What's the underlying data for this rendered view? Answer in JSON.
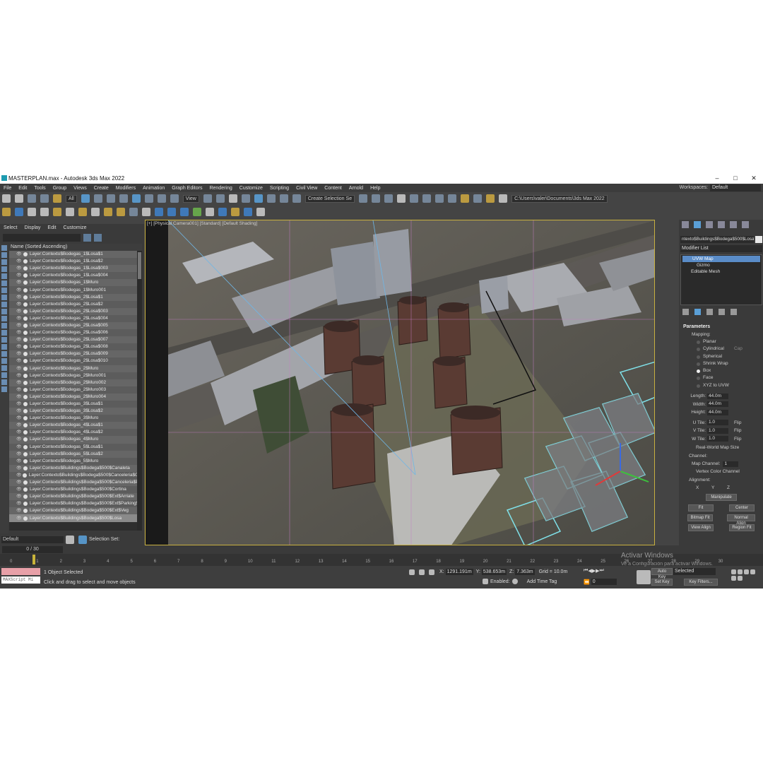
{
  "window": {
    "title": "MASTERPLAN.max - Autodesk 3ds Max 2022",
    "minimize": "–",
    "maximize": "□",
    "close": "✕"
  },
  "menu": [
    "File",
    "Edit",
    "Tools",
    "Group",
    "Views",
    "Create",
    "Modifiers",
    "Animation",
    "Graph Editors",
    "Rendering",
    "Customize",
    "Scripting",
    "Civil View",
    "Content",
    "Arnold",
    "Help"
  ],
  "workspaces": {
    "label": "Workspaces:",
    "value": "Default"
  },
  "toolbar": {
    "filter_all": "All",
    "ref_coord": "View",
    "selection_set": "Create Selection Se",
    "project_path": "C:\\Users\\valer\\Documents\\3ds Max 2022"
  },
  "scene_explorer": {
    "tabs": [
      "Select",
      "Display",
      "Edit",
      "Customize"
    ],
    "column_header": "Name (Sorted Ascending)",
    "rows": [
      "Layer:Contexto$Bodegas_1$Losa$1",
      "Layer:Contexto$Bodegas_1$Losa$2",
      "Layer:Contexto$Bodegas_1$Losa$003",
      "Layer:Contexto$Bodegas_1$Losa$004",
      "Layer:Contexto$Bodegas_1$Muro",
      "Layer:Contexto$Bodegas_1$Muro001",
      "Layer:Contexto$Bodegas_2$Losa$1",
      "Layer:Contexto$Bodegas_2$Losa$2",
      "Layer:Contexto$Bodegas_2$Losa$003",
      "Layer:Contexto$Bodegas_2$Losa$004",
      "Layer:Contexto$Bodegas_2$Losa$005",
      "Layer:Contexto$Bodegas_2$Losa$006",
      "Layer:Contexto$Bodegas_2$Losa$007",
      "Layer:Contexto$Bodegas_2$Losa$008",
      "Layer:Contexto$Bodegas_2$Losa$009",
      "Layer:Contexto$Bodegas_2$Losa$010",
      "Layer:Contexto$Bodegas_2$Muro",
      "Layer:Contexto$Bodegas_2$Muro001",
      "Layer:Contexto$Bodegas_2$Muro002",
      "Layer:Contexto$Bodegas_2$Muro003",
      "Layer:Contexto$Bodegas_2$Muro004",
      "Layer:Contexto$Bodegas_3$Losa$1",
      "Layer:Contexto$Bodegas_3$Losa$2",
      "Layer:Contexto$Bodegas_3$Muro",
      "Layer:Contexto$Bodegas_4$Losa$1",
      "Layer:Contexto$Bodegas_4$Losa$2",
      "Layer:Contexto$Bodegas_4$Muro",
      "Layer:Contexto$Bodegas_5$Losa$1",
      "Layer:Contexto$Bodegas_5$Losa$2",
      "Layer:Contexto$Bodegas_5$Muro",
      "Layer:Contexto$Buildings$Bodega$500$Canaleta",
      "Layer:Contexto$Buildings$Bodega$500$Canceleria$Gla",
      "Layer:Contexto$Buildings$Bodega$500$Canceleria$Pe",
      "Layer:Contexto$Buildings$Bodega$500$Cortina",
      "Layer:Contexto$Buildings$Bodega$500$Ext$Arriate",
      "Layer:Contexto$Buildings$Bodega$500$Ext$Parking$T",
      "Layer:Contexto$Buildings$Bodega$500$Ext$Veg",
      "Layer:Contexto$Buildings$Bodega$500$Losa"
    ],
    "selected_row": "Layer:Contexto$Buildings$Bodega$500$Losa",
    "layer_dropdown": "Default",
    "selection_set_label": "Selection Set:"
  },
  "viewport": {
    "label": "[+] [Physical Camera001] [Standard] [Default Shading]"
  },
  "command_panel": {
    "object_name": "ntexto$Buildings$Bodega$500$Losa",
    "modifier_list": "Modifier List",
    "stack": [
      "UVW Map",
      "Gizmo",
      "Editable Mesh"
    ],
    "parameters_title": "Parameters",
    "mapping_label": "Mapping:",
    "mapping_options": [
      "Planar",
      "Cylindrical",
      "Spherical",
      "Shrink Wrap",
      "Box",
      "Face",
      "XYZ to UVW"
    ],
    "mapping_selected": "Box",
    "cap_label": "Cap",
    "length_label": "Length:",
    "length": "44.0m",
    "width_label": "Width:",
    "width": "44.0m",
    "height_label": "Height:",
    "height": "44.0m",
    "utile_label": "U Tile:",
    "utile": "1.0",
    "vtile_label": "V Tile:",
    "vtile": "1.0",
    "wtile_label": "W Tile:",
    "wtile": "1.0",
    "flip_label": "Flip",
    "real_world": "Real-World Map Size",
    "channel_label": "Channel:",
    "map_channel_label": "Map Channel:",
    "map_channel": "1",
    "vertex_color": "Vertex Color Channel",
    "alignment_label": "Alignment:",
    "axes": [
      "X",
      "Y",
      "Z"
    ],
    "axis_selected": "Z",
    "buttons": [
      "Manipulate",
      "Fit",
      "Center",
      "Bitmap Fit",
      "Normal Align",
      "View Align",
      "Region Fit"
    ]
  },
  "timeline": {
    "frame_display": "0 / 30",
    "ticks": [
      "0",
      "5",
      "10",
      "15",
      "20",
      "25",
      "30"
    ],
    "ticks_all": [
      "1",
      "2",
      "3",
      "4",
      "5",
      "6",
      "7",
      "8",
      "9",
      "10",
      "11",
      "12",
      "13",
      "14",
      "15",
      "16",
      "17",
      "18",
      "19",
      "20",
      "21",
      "22",
      "23",
      "24",
      "25",
      "26",
      "27",
      "28",
      "29",
      "30"
    ]
  },
  "status": {
    "selected": "1 Object Selected",
    "hint": "Click and drag to select and move objects",
    "maxscript": "MAXScript Mi",
    "x_label": "X:",
    "x": "1291.191m",
    "y_label": "Y:",
    "y": "538.653m",
    "z_label": "Z:",
    "z": "7.363m",
    "grid": "Grid = 10.0m",
    "enabled": "Enabled:",
    "add_time_tag": "Add Time Tag",
    "auto_key": "Auto Key",
    "selected_dd": "Selected",
    "set_key": "Set Key",
    "key_filters": "Key Filters...",
    "frame_field": "0"
  },
  "watermark": {
    "line1": "Activar Windows",
    "line2": "Ve a Configuración para activar Windows."
  },
  "colors": {
    "accent": "#5a9fd6",
    "viewport_border": "#c8b040",
    "panel": "#444444"
  }
}
